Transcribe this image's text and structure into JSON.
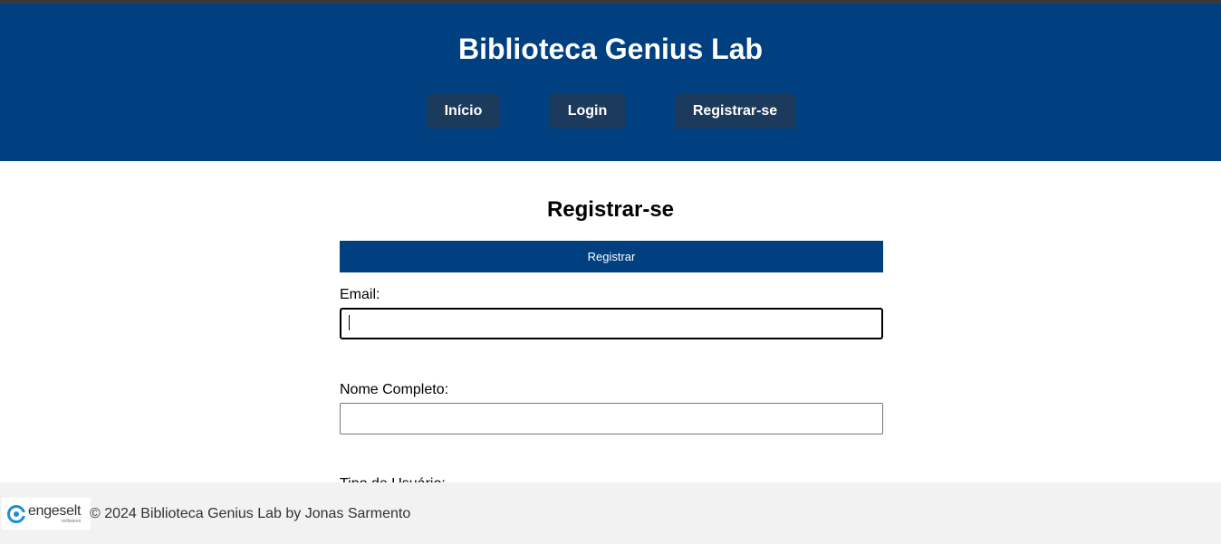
{
  "header": {
    "site_title": "Biblioteca Genius Lab",
    "nav": [
      {
        "label": "Início"
      },
      {
        "label": "Login"
      },
      {
        "label": "Registrar-se"
      }
    ]
  },
  "main": {
    "heading": "Registrar-se",
    "submit_label": "Registrar",
    "fields": {
      "email": {
        "label": "Email:",
        "value": ""
      },
      "nome": {
        "label": "Nome Completo:",
        "value": ""
      },
      "tipo": {
        "label": "Tipo de Usuário:"
      }
    }
  },
  "footer": {
    "logo_text": "engeselt",
    "logo_subtext": "softwares",
    "copyright": "© 2024 Biblioteca Genius Lab by Jonas Sarmento"
  },
  "colors": {
    "header_bg": "#004080",
    "nav_button_bg": "#1b3a5c",
    "footer_bg": "#f2f2f2",
    "logo_accent": "#1a8fd8"
  }
}
